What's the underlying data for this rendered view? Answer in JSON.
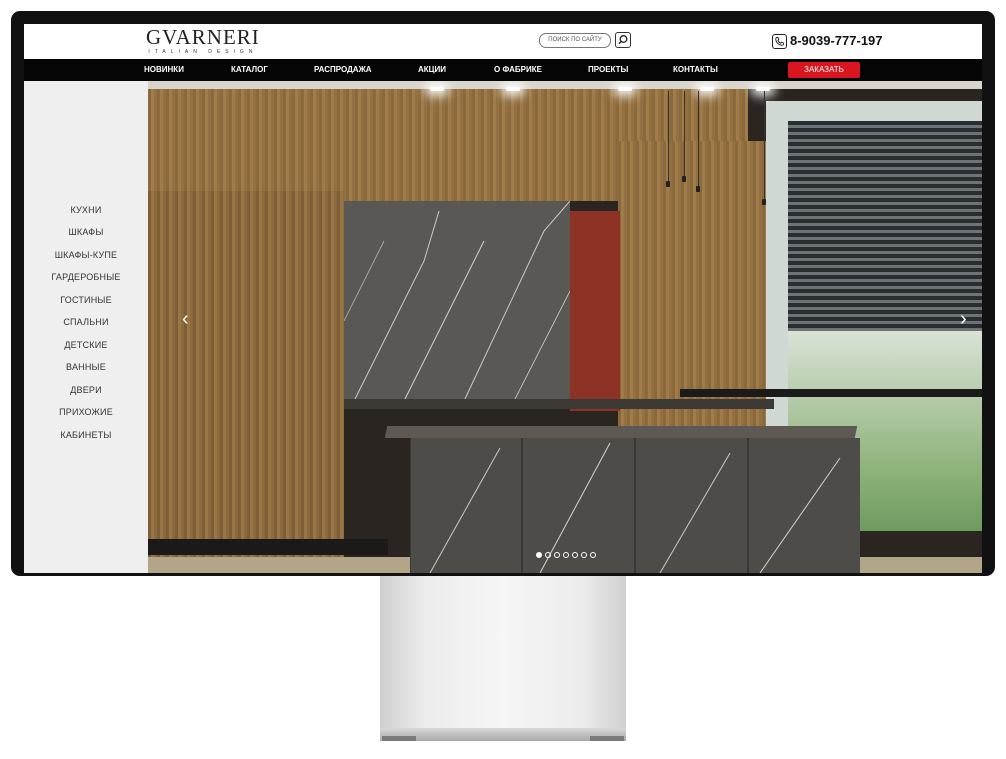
{
  "header": {
    "logo": {
      "name": "GVARNERI",
      "tagline": "ITALIAN DESIGN"
    },
    "search": {
      "placeholder": "ПОИСК ПО САЙТУ",
      "icon": "search-icon"
    },
    "phone": {
      "icon": "phone-icon",
      "number": "8-9039-777-197"
    }
  },
  "nav": {
    "items": [
      "НОВИНКИ",
      "КАТАЛОГ",
      "РАСПРОДАЖА",
      "АКЦИИ",
      "О ФАБРИКЕ",
      "ПРОЕКТЫ",
      "КОНТАКТЫ"
    ],
    "cta": "ЗАКАЗАТЬ ПРОЕКТ"
  },
  "sidebar": {
    "items": [
      "КУХНИ",
      "ШКАФЫ",
      "ШКАФЫ-КУПЕ",
      "ГАРДЕРОБНЫЕ",
      "ГОСТИНЫЕ",
      "СПАЛЬНИ",
      "ДЕТСКИЕ",
      "ВАННЫЕ",
      "ДВЕРИ",
      "ПРИХОЖИЕ",
      "КАБИНЕТЫ"
    ]
  },
  "slider": {
    "prev_icon": "chevron-left-icon",
    "next_icon": "chevron-right-icon",
    "slides_count": 7,
    "active_slide": 1
  },
  "colors": {
    "nav_bg": "#050505",
    "accent": "#d9161f",
    "sidebar_bg": "#efefef"
  }
}
